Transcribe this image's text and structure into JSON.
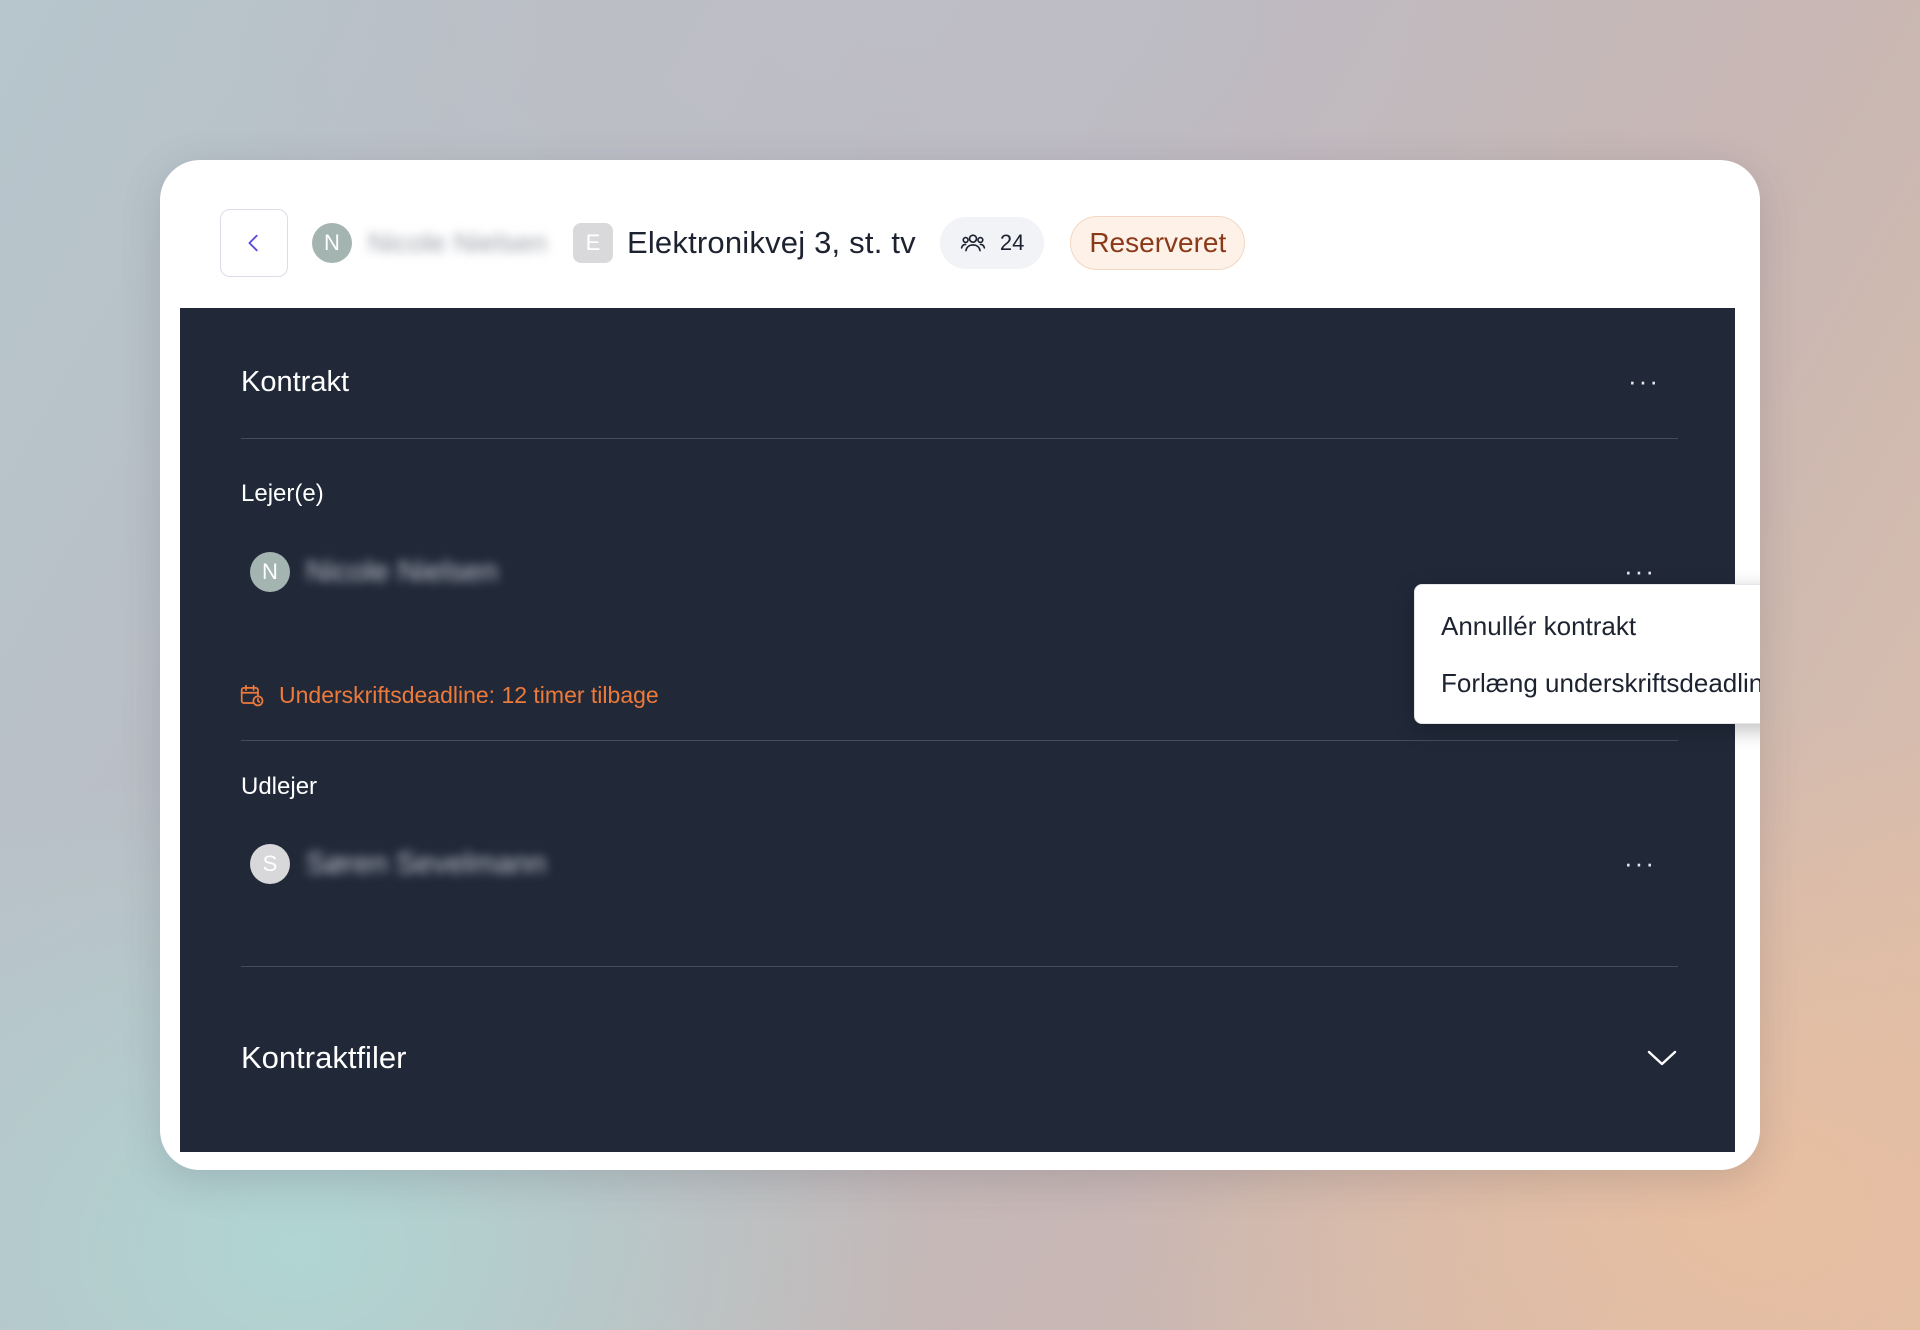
{
  "header": {
    "back_label": "",
    "owner_initial": "N",
    "owner_name": "Nicole Nielsen",
    "unit_initial": "E",
    "address": "Elektronikvej 3, st. tv",
    "people_count": "24",
    "status": "Reserveret"
  },
  "contract": {
    "title": "Kontrakt",
    "more_label": "···",
    "tenants_label": "Lejer(e)",
    "tenant": {
      "initial": "N",
      "name": "Nicole Nielsen",
      "more_label": "···"
    },
    "deadline_text": "Underskriftsdeadline: 12 timer tilbage",
    "landlord_label": "Udlejer",
    "landlord": {
      "initial": "S",
      "name": "Søren Sevelmann",
      "more_label": "···"
    },
    "files_title": "Kontraktfiler"
  },
  "menu": {
    "items": [
      {
        "label": "Annullér kontrakt"
      },
      {
        "label": "Forlæng underskriftsdeadline"
      }
    ]
  },
  "colors": {
    "panel_bg": "#212939",
    "deadline_accent": "#ee7a3a",
    "status_text": "#8a3a18",
    "back_arrow": "#5b4be0"
  }
}
